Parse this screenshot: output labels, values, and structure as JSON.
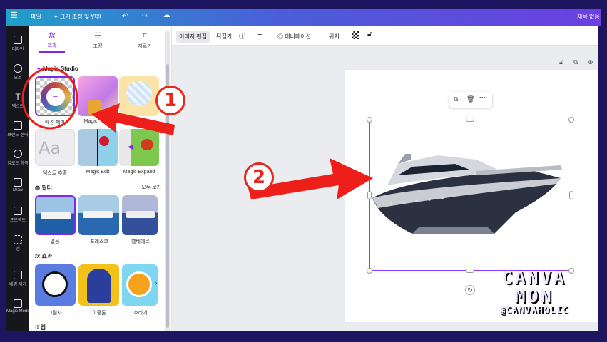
{
  "topbar": {
    "menu_icon": "hamburger-icon",
    "file_label": "파일",
    "resize_label": "크기 조정 및 변환",
    "title_right": "제목 없음"
  },
  "rail": [
    {
      "label": "디자인",
      "icon": "layout-icon"
    },
    {
      "label": "요소",
      "icon": "shapes-icon"
    },
    {
      "label": "텍스트",
      "icon": "text-icon"
    },
    {
      "label": "브랜드 센터",
      "icon": "brand-icon"
    },
    {
      "label": "업로드 항목",
      "icon": "cloud-upload-icon"
    },
    {
      "label": "Draw",
      "icon": "pen-icon"
    },
    {
      "label": "프로젝트",
      "icon": "folder-icon"
    },
    {
      "label": "앱",
      "icon": "apps-grid-icon"
    },
    {
      "label": "배경 제거",
      "icon": "bg-remove-icon"
    },
    {
      "label": "Magic Media",
      "icon": "magic-media-icon"
    }
  ],
  "panel": {
    "tabs": [
      "효과",
      "조정",
      "자르기"
    ],
    "magic_studio_title": "Magic Studio",
    "magic_tools": [
      "배경 제거",
      "Magic",
      "",
      "텍스트 추출",
      "Magic Edit",
      "Magic Expand"
    ],
    "filters_title": "필터",
    "see_all": "모두 보기",
    "filters": [
      "없음",
      "프레스코",
      "벨베데르"
    ],
    "effects_title": "효과",
    "effects": [
      "그림자",
      "이중톤",
      "흐리기"
    ],
    "apps_title": "앱"
  },
  "toolbar": {
    "edit_image": "이미지 편집",
    "flip": "뒤집기",
    "animate": "애니메이션",
    "position": "위치"
  },
  "annotations": {
    "badge1": "1",
    "badge2": "2"
  },
  "watermark": {
    "line1": "CANVA",
    "line2": "MON",
    "line3": "@CANVAHOLIC"
  }
}
